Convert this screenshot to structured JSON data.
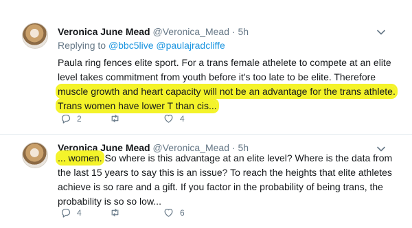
{
  "tweets": [
    {
      "author_name": "Veronica June Mead",
      "author_handle": "@Veronica_Mead",
      "separator": "·",
      "time": "5h",
      "reply_prefix": "Replying to",
      "reply_mentions": [
        "@bbc5live",
        "@paulajradcliffe"
      ],
      "lines": [
        "Paula ring fences elite sport. For a trans female athelete to compete at an elite",
        "level takes commitment from youth before it's too late to be elite. Therefore",
        "muscle growth and heart capacity will not be an advantage for the trans athlete.",
        "Trans women have lower T than cis..."
      ],
      "reply_count": "2",
      "retweet_count": "",
      "like_count": "4"
    },
    {
      "author_name": "Veronica June Mead",
      "author_handle": "@Veronica_Mead",
      "separator": "·",
      "time": "5h",
      "line1_highlight": "... women.",
      "line1_rest": " So where is this advantage at an elite level? Where is the data from",
      "lines": [
        "the last 15 years to say this is an issue? To reach the heights that elite athletes",
        "achieve is so rare and a gift. If you factor in the probability of being trans, the",
        "probability is so so low..."
      ],
      "reply_count": "4",
      "retweet_count": "",
      "like_count": "6"
    }
  ],
  "colors": {
    "highlight": "#f4f32a",
    "link": "#1b95e0",
    "muted": "#657786"
  },
  "icons": {
    "menu": "chevron-down-icon",
    "reply": "reply-icon",
    "retweet": "retweet-icon",
    "like": "heart-icon"
  }
}
